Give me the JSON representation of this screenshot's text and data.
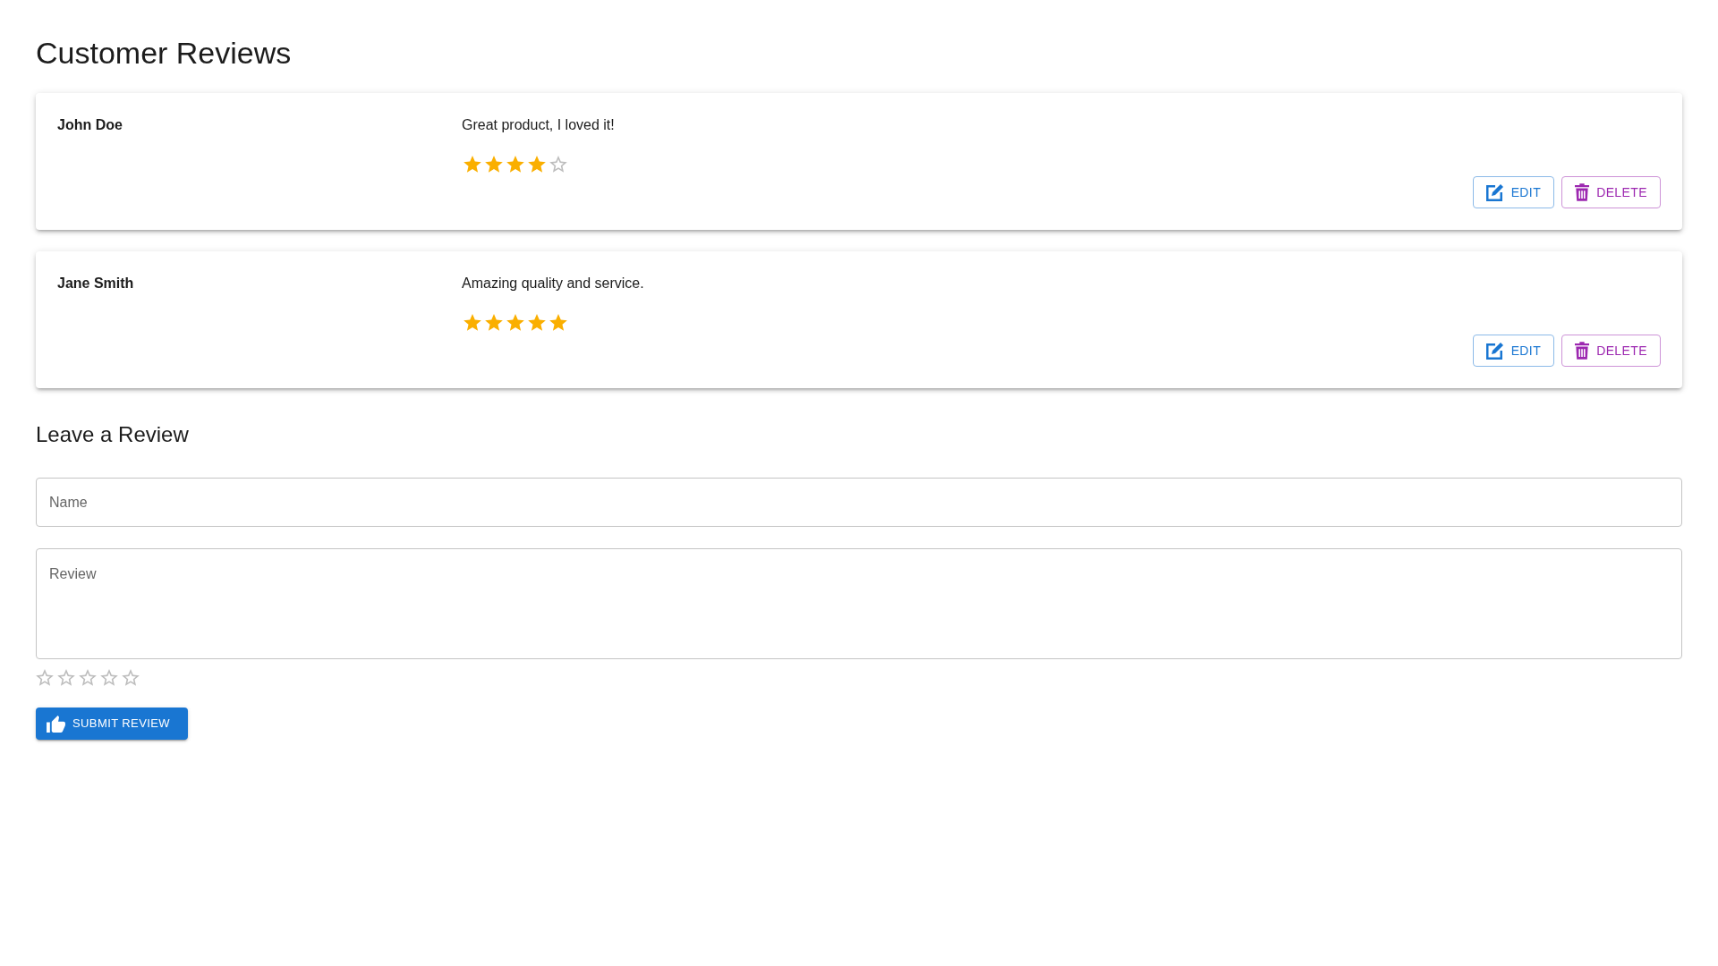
{
  "page": {
    "title": "Customer Reviews"
  },
  "reviews": [
    {
      "name": "John Doe",
      "comment": "Great product, I loved it!",
      "stars": 4,
      "actions": [
        {
          "kind": "edit",
          "label": "EDIT"
        },
        {
          "kind": "delete",
          "label": "DELETE"
        }
      ]
    },
    {
      "name": "Jane Smith",
      "comment": "Amazing quality and service.",
      "stars": 5,
      "actions": [
        {
          "kind": "edit",
          "label": "EDIT"
        },
        {
          "kind": "delete",
          "label": "DELETE"
        }
      ]
    }
  ],
  "form": {
    "title": "Leave a Review",
    "fields": [
      {
        "kind": "text",
        "placeholder": "Name"
      },
      {
        "kind": "textarea",
        "placeholder": "Review"
      }
    ],
    "stars": 0,
    "submit": {
      "label": "SUBMIT REVIEW"
    }
  }
}
